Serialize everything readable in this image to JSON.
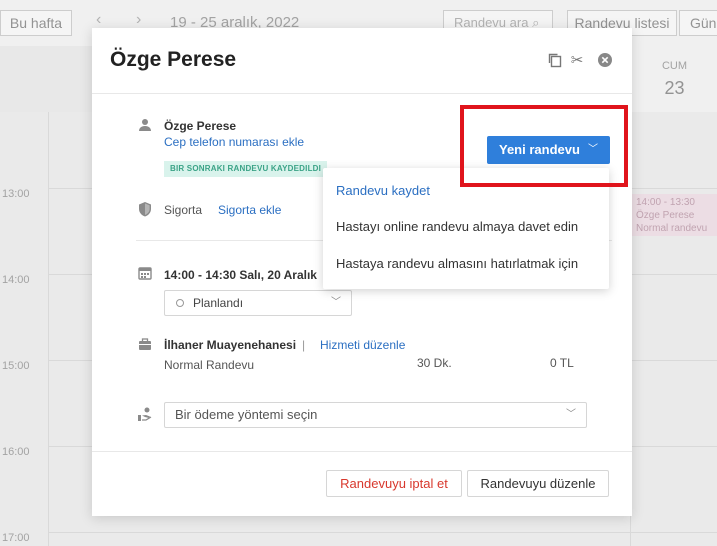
{
  "toolbar": {
    "this_week": "Bu hafta",
    "date_range": "19 - 25 aralık, 2022",
    "search_placeholder": "Randevu ara",
    "appointment_list": "Randevu listesi",
    "day_view": "Gün"
  },
  "calendar": {
    "day_name": "CUM",
    "day_number": "23",
    "hours": [
      "13:00",
      "14:00",
      "15:00",
      "16:00",
      "17:00"
    ],
    "event_time": "14:00 - 13:30",
    "event_name": "Özge Perese",
    "event_type": "Normal randevu"
  },
  "modal": {
    "title": "Özge Perese",
    "patient_name": "Özge Perese",
    "add_phone": "Cep telefon numarası ekle",
    "next_badge": "BIR SONRAKI RANDEVU KAYDEDILDI",
    "new_appointment": "Yeni randevu",
    "insurance_label": "Sigorta",
    "insurance_link": "Sigorta ekle",
    "time": "14:00 - 14:30 Salı, 20 Aralık",
    "status": "Planlandı",
    "clinic": "İlhaner Muayenehanesi",
    "edit_service": "Hizmeti düzenle",
    "service_name": "Normal Randevu",
    "service_duration": "30 Dk.",
    "service_price": "0 TL",
    "payment_placeholder": "Bir ödeme yöntemi seçin",
    "cancel_button": "Randevuyu iptal et",
    "edit_button": "Randevuyu düzenle"
  },
  "dropdown": {
    "items": [
      "Randevu kaydet",
      "Hastayı online randevu almaya davet edin",
      "Hastaya randevu almasını hatırlatmak için"
    ]
  },
  "colors": {
    "accent": "#2f7fdb",
    "danger": "#d8382d",
    "highlight": "#e0141c",
    "badge_bg": "#d9f3ec"
  }
}
